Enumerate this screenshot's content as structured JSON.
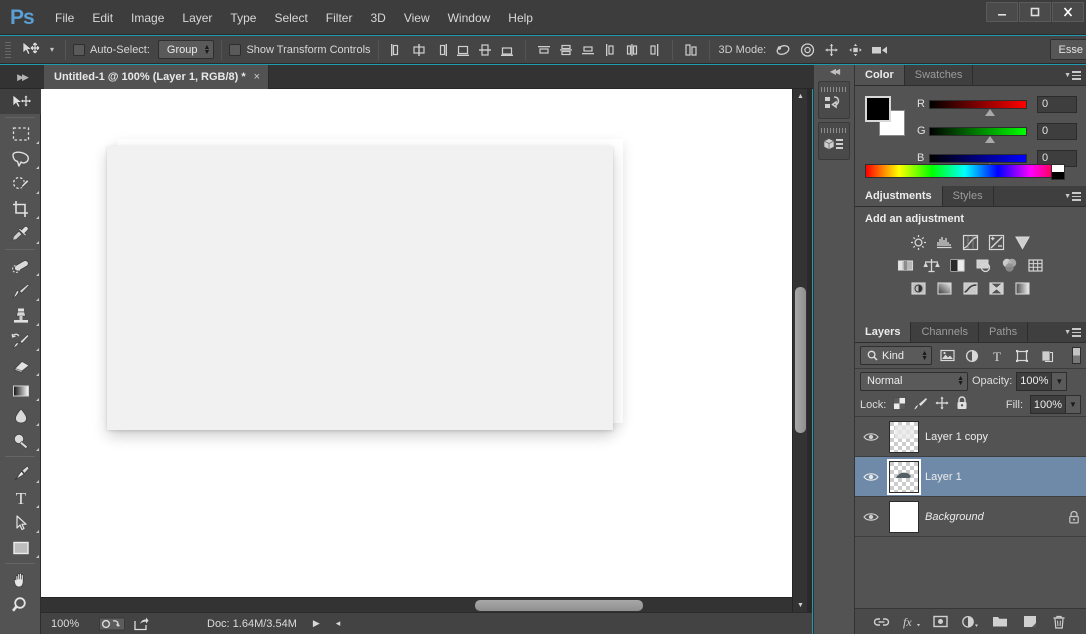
{
  "app": {
    "logo": "Ps",
    "menu": [
      "File",
      "Edit",
      "Image",
      "Layer",
      "Type",
      "Select",
      "Filter",
      "3D",
      "View",
      "Window",
      "Help"
    ],
    "window_controls": {
      "minimize": "minimize-icon",
      "maximize": "maximize-icon",
      "close": "close-icon"
    }
  },
  "options_bar": {
    "tool_icon": "move-tool-icon",
    "tool_preset_caret": "▾",
    "auto_select_label": "Auto-Select:",
    "auto_select_checked": false,
    "auto_select_scope": "Group",
    "show_transform_label": "Show Transform Controls",
    "show_transform_checked": false,
    "align_icons": [
      "align-left-edges-icon",
      "align-horizontal-centers-icon",
      "align-right-edges-icon",
      "align-top-edges-icon",
      "align-vertical-centers-icon",
      "align-bottom-edges-icon",
      "distribute-top-edges-icon",
      "distribute-vertical-centers-icon",
      "distribute-bottom-edges-icon",
      "distribute-left-edges-icon",
      "distribute-horizontal-centers-icon",
      "distribute-right-edges-icon"
    ],
    "auto_align_icon": "auto-align-layers-icon",
    "mode3d_label": "3D Mode:",
    "mode3d_icons": [
      "orbit-3d-icon",
      "roll-3d-icon",
      "pan-3d-icon",
      "slide-3d-icon",
      "zoom-3d-camera-icon"
    ],
    "workspace_button": "Esse"
  },
  "tabstrip": {
    "collapse_icon": "collapse-panels-icon",
    "document_tab": {
      "title": "Untitled-1 @ 100% (Layer 1, RGB/8) *",
      "close": "×"
    }
  },
  "toolbar": {
    "tools": [
      {
        "name": "move-tool",
        "label": "Move Tool",
        "active": true,
        "corner": false
      },
      {
        "name": "rectangular-marquee-tool",
        "label": "Rectangular Marquee Tool",
        "active": false,
        "corner": true
      },
      {
        "name": "lasso-tool",
        "label": "Lasso Tool",
        "active": false,
        "corner": true
      },
      {
        "name": "quick-selection-tool",
        "label": "Quick Selection Tool",
        "active": false,
        "corner": true
      },
      {
        "name": "crop-tool",
        "label": "Crop Tool",
        "active": false,
        "corner": true
      },
      {
        "name": "eyedropper-tool",
        "label": "Eyedropper Tool",
        "active": false,
        "corner": true
      },
      {
        "name": "spot-healing-brush-tool",
        "label": "Spot Healing Brush Tool",
        "active": false,
        "corner": true
      },
      {
        "name": "brush-tool",
        "label": "Brush Tool",
        "active": false,
        "corner": true
      },
      {
        "name": "clone-stamp-tool",
        "label": "Clone Stamp Tool",
        "active": false,
        "corner": true
      },
      {
        "name": "history-brush-tool",
        "label": "History Brush Tool",
        "active": false,
        "corner": true
      },
      {
        "name": "eraser-tool",
        "label": "Eraser Tool",
        "active": false,
        "corner": true
      },
      {
        "name": "gradient-tool",
        "label": "Gradient Tool",
        "active": false,
        "corner": true
      },
      {
        "name": "blur-tool",
        "label": "Blur Tool",
        "active": false,
        "corner": true
      },
      {
        "name": "dodge-tool",
        "label": "Dodge Tool",
        "active": false,
        "corner": true
      },
      {
        "name": "pen-tool",
        "label": "Pen Tool",
        "active": false,
        "corner": true
      },
      {
        "name": "horizontal-type-tool",
        "label": "Horizontal Type Tool",
        "active": false,
        "corner": true
      },
      {
        "name": "path-selection-tool",
        "label": "Path Selection Tool",
        "active": false,
        "corner": true
      },
      {
        "name": "rectangle-tool",
        "label": "Rectangle Tool",
        "active": false,
        "corner": true
      },
      {
        "name": "hand-tool",
        "label": "Hand Tool",
        "active": false,
        "corner": false
      },
      {
        "name": "zoom-tool",
        "label": "Zoom Tool",
        "active": false,
        "corner": false
      }
    ]
  },
  "canvas": {
    "background_color": "#ffffff",
    "artboard_color": "#f1f1f1",
    "scroll_up_icon": "▲",
    "scroll_down_icon": "▼"
  },
  "status_bar": {
    "zoom": "100%",
    "icons": [
      "document-settings-icon",
      "share-icon"
    ],
    "doc_info": "Doc: 1.64M/3.54M",
    "play_icon": "▶",
    "left_arrow_icon": "◂"
  },
  "mini_dock": {
    "collapse_icon": "collapse-to-icons-icon",
    "buttons": [
      {
        "name": "history-panel-icon",
        "label": "History"
      },
      {
        "name": "properties-3d-panel-icon",
        "label": "Properties"
      }
    ]
  },
  "color_panel": {
    "tabs": [
      {
        "label": "Color",
        "active": true
      },
      {
        "label": "Swatches",
        "active": false
      }
    ],
    "menu_icon": "panel-menu-icon",
    "foreground_color": "#000000",
    "background_color": "#ffffff",
    "channels": [
      {
        "label": "R",
        "value": "0"
      },
      {
        "label": "G",
        "value": "0"
      },
      {
        "label": "B",
        "value": "0"
      }
    ]
  },
  "adjustments_panel": {
    "tabs": [
      {
        "label": "Adjustments",
        "active": true
      },
      {
        "label": "Styles",
        "active": false
      }
    ],
    "menu_icon": "panel-menu-icon",
    "heading": "Add an adjustment",
    "row1": [
      "brightness-contrast-icon",
      "levels-icon",
      "curves-icon",
      "exposure-icon",
      "vibrance-icon"
    ],
    "row2": [
      "hue-saturation-icon",
      "color-balance-icon",
      "black-white-icon",
      "photo-filter-icon",
      "channel-mixer-icon",
      "color-lookup-icon"
    ],
    "row3": [
      "invert-icon",
      "posterize-icon",
      "threshold-icon",
      "selective-color-icon",
      "gradient-map-icon"
    ]
  },
  "layers_panel": {
    "tabs": [
      {
        "label": "Layers",
        "active": true
      },
      {
        "label": "Channels",
        "active": false
      },
      {
        "label": "Paths",
        "active": false
      }
    ],
    "menu_icon": "panel-menu-icon",
    "filter": {
      "search_icon": "search-icon",
      "kind_label": "Kind",
      "icons": [
        "filter-pixel-icon",
        "filter-adjustment-icon",
        "filter-type-icon",
        "filter-shape-icon",
        "filter-smart-object-icon"
      ],
      "toggle_icon": "filter-enable-toggle"
    },
    "blend_mode": "Normal",
    "opacity_label": "Opacity:",
    "opacity_value": "100%",
    "lock_label": "Lock:",
    "lock_icons": [
      "lock-transparent-pixels-icon",
      "lock-image-pixels-icon",
      "lock-position-icon",
      "lock-all-icon"
    ],
    "fill_label": "Fill:",
    "fill_value": "100%",
    "layers": [
      {
        "name": "Layer 1 copy",
        "visible": true,
        "selected": false,
        "locked": false,
        "thumb": "transparent-soft",
        "italic": false
      },
      {
        "name": "Layer 1",
        "visible": true,
        "selected": true,
        "locked": false,
        "thumb": "transparent-shape",
        "italic": false
      },
      {
        "name": "Background",
        "visible": true,
        "selected": false,
        "locked": true,
        "thumb": "white",
        "italic": true
      }
    ],
    "footer_icons": [
      "link-layers-icon",
      "layer-style-fx-icon",
      "add-layer-mask-icon",
      "new-adjustment-layer-icon",
      "new-group-icon",
      "new-layer-icon",
      "delete-layer-icon"
    ]
  },
  "colors": {
    "app_background": "#1e9bb0",
    "panel_bg": "#535353",
    "panel_tab_bg": "#3f3f3f",
    "menubar_bg": "#3d3d3d",
    "options_bg": "#454545",
    "selected_layer": "#6e8aa8",
    "doc_window_bg": "#292929"
  }
}
